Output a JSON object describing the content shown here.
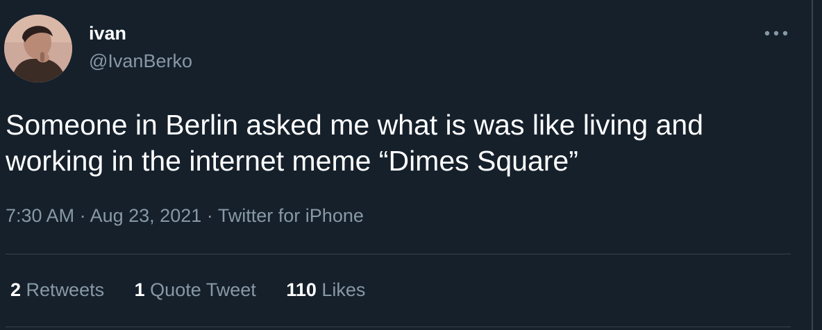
{
  "colors": {
    "background": "#15202b",
    "primary_text": "#ffffff",
    "secondary_text": "#8899a6",
    "divider": "#38444d"
  },
  "author": {
    "display_name": "ivan",
    "handle": "@IvanBerko",
    "avatar_icon": "profile-photo"
  },
  "more_icon": "more-horizontal-icon",
  "tweet": {
    "text": "Someone in Berlin asked me what is was like living and working in the internet meme “Dimes Square”",
    "time": "7:30 AM",
    "date": "Aug 23, 2021",
    "source": "Twitter for iPhone",
    "separator": "·"
  },
  "stats": {
    "retweets_count": "2",
    "retweets_label": "Retweets",
    "quotes_count": "1",
    "quotes_label": "Quote Tweet",
    "likes_count": "110",
    "likes_label": "Likes"
  }
}
